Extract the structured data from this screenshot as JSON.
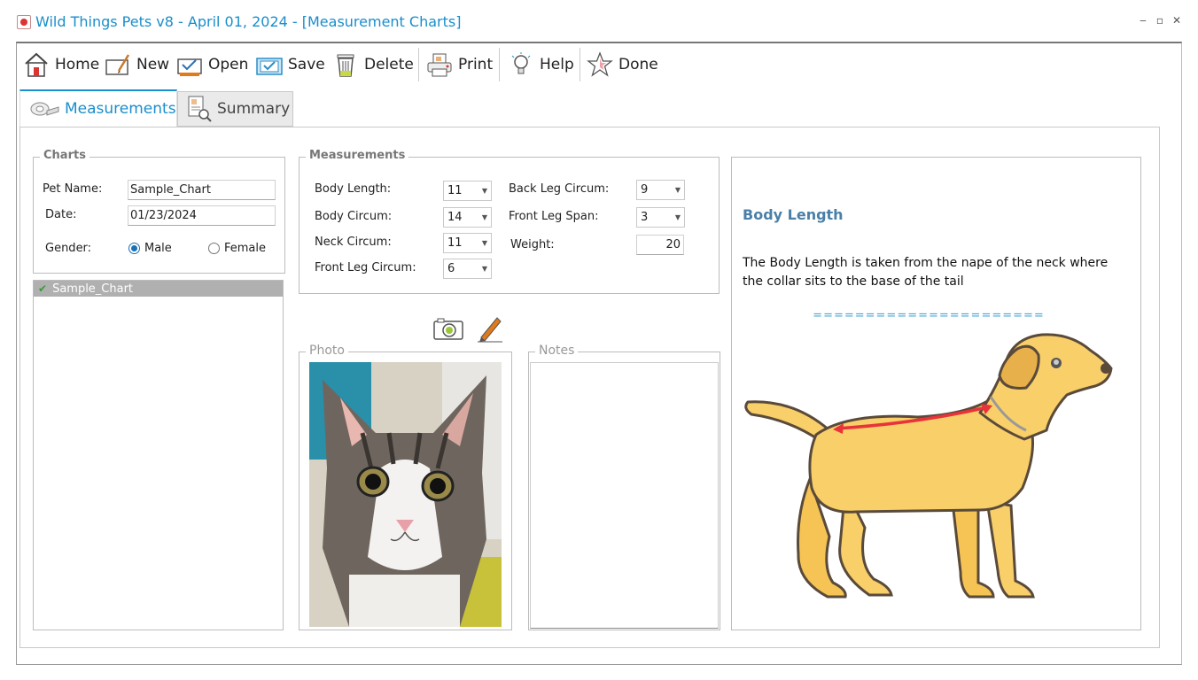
{
  "window": {
    "title": "Wild Things Pets v8 - April 01, 2024 - [Measurement Charts]",
    "minimize": "‒",
    "maximize": "▫",
    "close": "✕"
  },
  "toolbar": {
    "home": "Home",
    "new": "New",
    "open": "Open",
    "save": "Save",
    "delete": "Delete",
    "print": "Print",
    "help": "Help",
    "done": "Done"
  },
  "tabs": {
    "measurements": "Measurements",
    "summary": "Summary"
  },
  "charts": {
    "legend": "Charts",
    "pet_name_label": "Pet Name:",
    "pet_name_value": "Sample_Chart",
    "date_label": "Date:",
    "date_value": "01/23/2024",
    "gender_label": "Gender:",
    "male_label": "Male",
    "female_label": "Female",
    "gender_selected": "Male",
    "list": [
      "Sample_Chart"
    ]
  },
  "measurements": {
    "legend": "Measurements",
    "body_length_label": "Body Length:",
    "body_length_value": "11",
    "body_circum_label": "Body Circum:",
    "body_circum_value": "14",
    "neck_circum_label": "Neck Circum:",
    "neck_circum_value": "11",
    "front_leg_circum_label": "Front Leg Circum:",
    "front_leg_circum_value": "6",
    "back_leg_circum_label": "Back Leg Circum:",
    "back_leg_circum_value": "9",
    "front_leg_span_label": "Front Leg Span:",
    "front_leg_span_value": "3",
    "weight_label": "Weight:",
    "weight_value": "20"
  },
  "photo": {
    "legend": "Photo"
  },
  "notes": {
    "legend": "Notes",
    "value": ""
  },
  "info": {
    "title": "Body Length",
    "description": "The Body Length is taken from the nape of the neck where the collar sits to the base of the tail",
    "divider": "======================"
  },
  "colors": {
    "accent": "#1a8ecb",
    "info_title": "#4a7fa8",
    "dog_fill": "#f9cf6a",
    "dog_outline": "#5a4a3a",
    "measure_arrow": "#e8333a"
  }
}
